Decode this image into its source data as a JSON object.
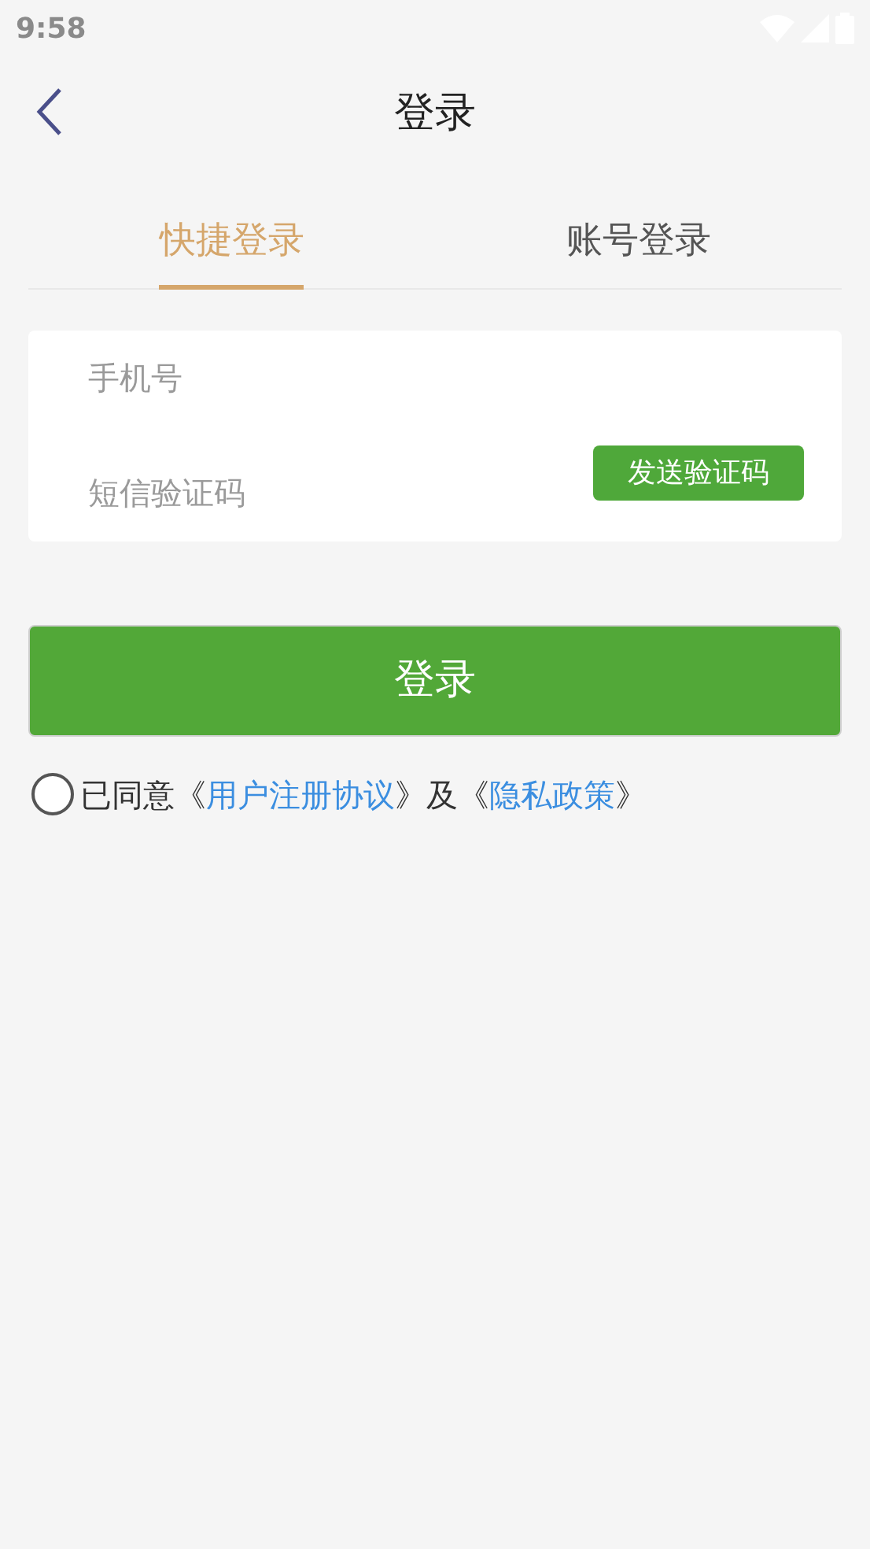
{
  "status_bar": {
    "time": "9:58"
  },
  "header": {
    "title": "登录"
  },
  "tabs": [
    {
      "label": "快捷登录",
      "selected": true
    },
    {
      "label": "账号登录",
      "selected": false
    }
  ],
  "fields": [
    {
      "placeholder": "手机号"
    },
    {
      "placeholder": "短信验证码",
      "button": "发送验证码"
    }
  ],
  "login_button": "登录",
  "agreement": {
    "checked": false,
    "parts": [
      {
        "kind": "text",
        "text": "已同意《"
      },
      {
        "kind": "link",
        "text": "用户注册协议"
      },
      {
        "kind": "text",
        "text": "》及《"
      },
      {
        "kind": "link",
        "text": "隐私政策"
      },
      {
        "kind": "text",
        "text": "》"
      }
    ]
  }
}
